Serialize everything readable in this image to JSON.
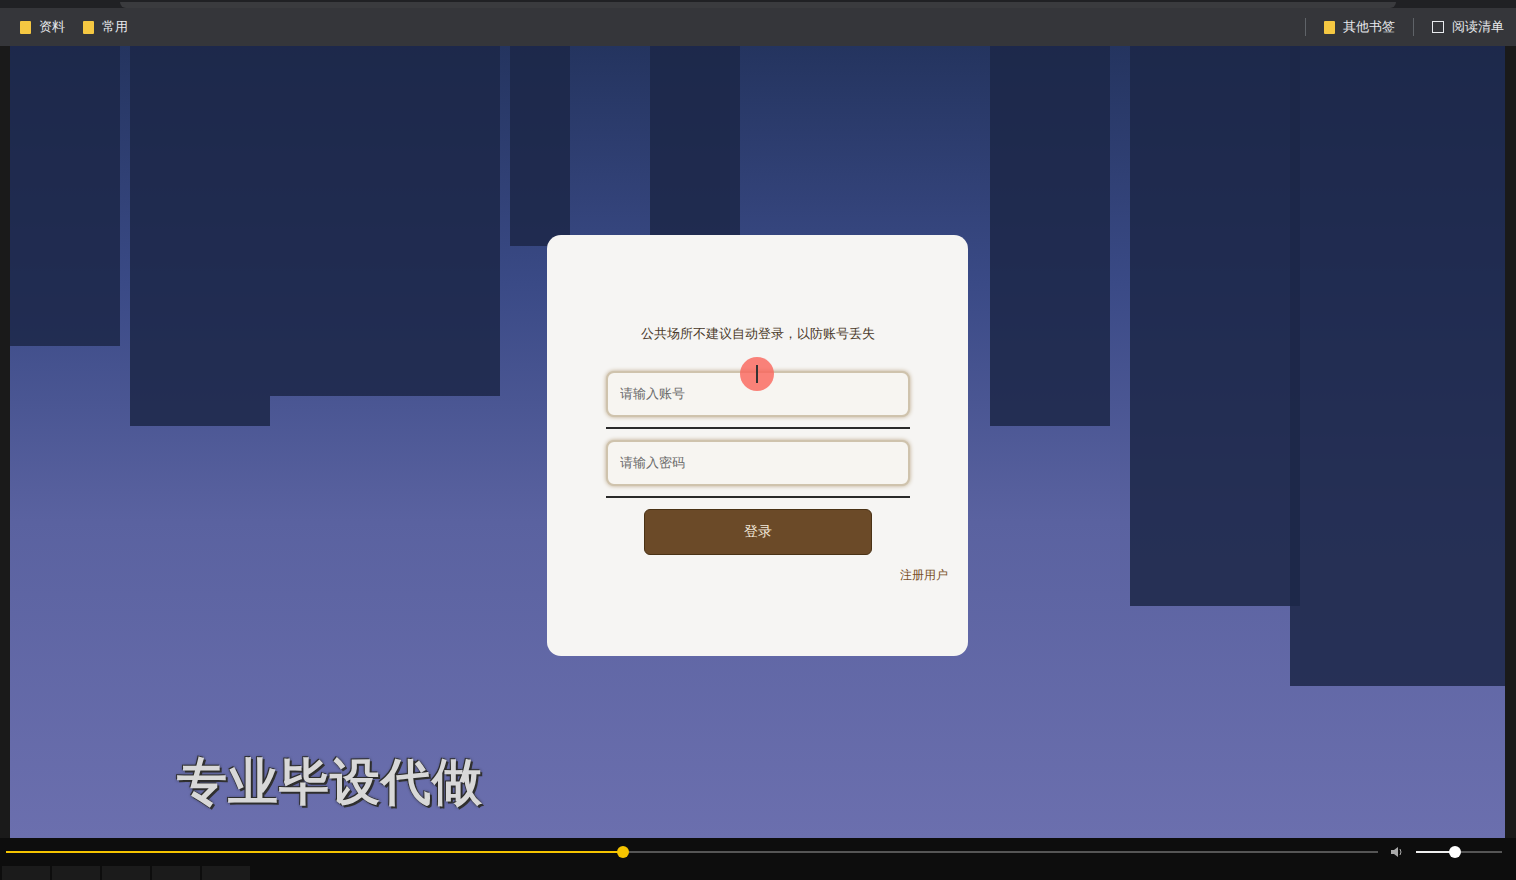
{
  "browser": {
    "bookmarks": [
      {
        "label": "资料"
      },
      {
        "label": "常用"
      }
    ],
    "bookmarks_right": [
      {
        "label": "其他书签"
      },
      {
        "label": "阅读清单"
      }
    ]
  },
  "login": {
    "notice": "公共场所不建议自动登录，以防账号丢失",
    "username": {
      "placeholder": "请输入账号"
    },
    "password": {
      "placeholder": "请输入密码"
    },
    "submit": "登录",
    "register": "注册用户"
  },
  "watermark": "专业毕设代做",
  "player": {
    "progress": {
      "level": 0.45
    },
    "volume": {
      "level": 0.45
    }
  }
}
